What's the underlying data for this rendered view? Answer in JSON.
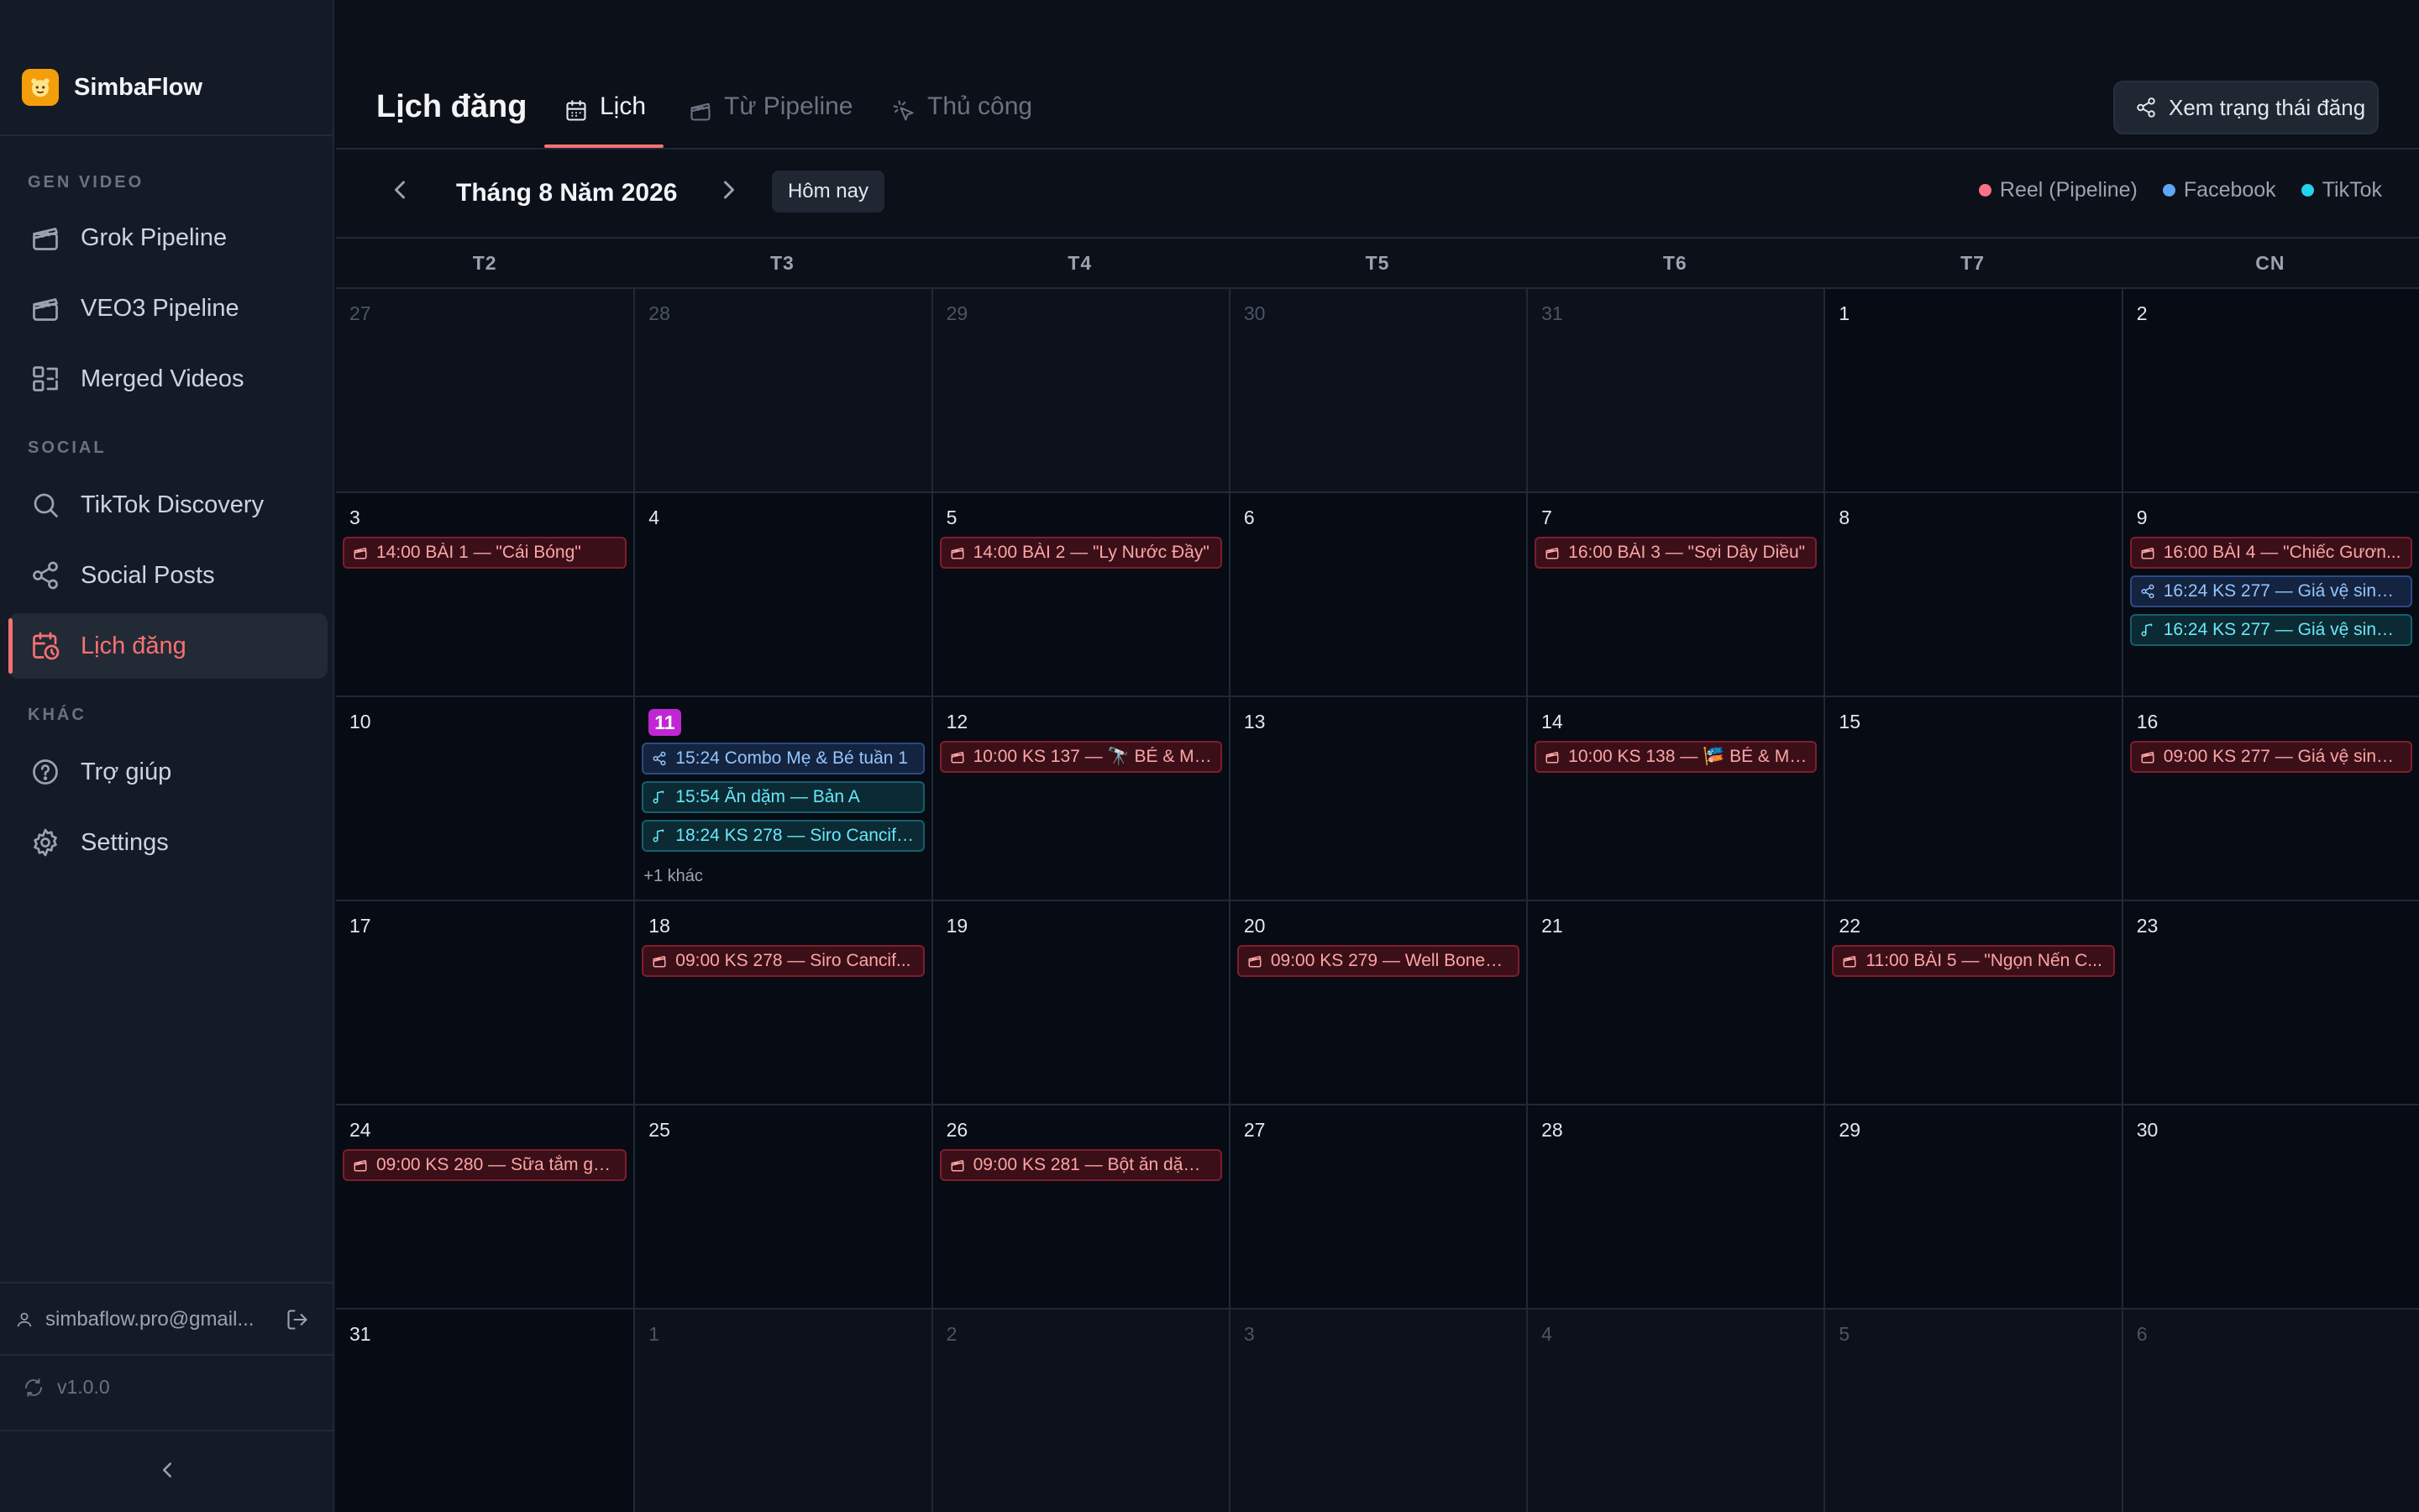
{
  "app": {
    "name": "SimbaFlow"
  },
  "sidebar": {
    "sections": [
      {
        "title": "GEN VIDEO",
        "items": [
          {
            "label": "Grok Pipeline",
            "icon": "clapperboard-icon"
          },
          {
            "label": "VEO3 Pipeline",
            "icon": "clapperboard-icon"
          },
          {
            "label": "Merged Videos",
            "icon": "merge-icon"
          }
        ]
      },
      {
        "title": "SOCIAL",
        "items": [
          {
            "label": "TikTok Discovery",
            "icon": "search-icon"
          },
          {
            "label": "Social Posts",
            "icon": "share-icon"
          },
          {
            "label": "Lịch đăng",
            "icon": "calendar-clock-icon",
            "active": true
          }
        ]
      },
      {
        "title": "KHÁC",
        "items": [
          {
            "label": "Trợ giúp",
            "icon": "help-circle-icon"
          },
          {
            "label": "Settings",
            "icon": "gear-icon"
          }
        ]
      }
    ],
    "user_email": "simbaflow.pro@gmail...",
    "version": "v1.0.0"
  },
  "header": {
    "title": "Lịch đăng",
    "tabs": [
      {
        "label": "Lịch",
        "icon": "calendar-icon",
        "active": true
      },
      {
        "label": "Từ Pipeline",
        "icon": "clapperboard-icon"
      },
      {
        "label": "Thủ công",
        "icon": "pointer-click-icon"
      }
    ],
    "status_button": "Xem trạng thái đăng"
  },
  "toolbar": {
    "month_label": "Tháng 8 Năm 2026",
    "today_label": "Hôm nay"
  },
  "legend": [
    {
      "label": "Reel (Pipeline)",
      "color": "#fb7185"
    },
    {
      "label": "Facebook",
      "color": "#60a5fa"
    },
    {
      "label": "TikTok",
      "color": "#22d3ee"
    }
  ],
  "colors": {
    "accent": "#f87171",
    "today": "#c026d3",
    "reel": "#fb7185",
    "facebook": "#60a5fa",
    "tiktok": "#22d3ee"
  },
  "weekdays": [
    "T2",
    "T3",
    "T4",
    "T5",
    "T6",
    "T7",
    "CN"
  ],
  "days": [
    {
      "d": "27",
      "out": true
    },
    {
      "d": "28",
      "out": true
    },
    {
      "d": "29",
      "out": true
    },
    {
      "d": "30",
      "out": true
    },
    {
      "d": "31",
      "out": true
    },
    {
      "d": "1"
    },
    {
      "d": "2"
    },
    {
      "d": "3",
      "events": [
        {
          "type": "reel",
          "text": "14:00 BÀI 1 — \"Cái Bóng\""
        }
      ]
    },
    {
      "d": "4"
    },
    {
      "d": "5",
      "events": [
        {
          "type": "reel",
          "text": "14:00 BÀI 2 — \"Ly Nước Đầy\""
        }
      ]
    },
    {
      "d": "6"
    },
    {
      "d": "7",
      "events": [
        {
          "type": "reel",
          "text": "16:00 BÀI 3 — \"Sợi Dây Diều\""
        }
      ]
    },
    {
      "d": "8"
    },
    {
      "d": "9",
      "events": [
        {
          "type": "reel",
          "text": "16:00 BÀI 4 — \"Chiếc Gươn..."
        },
        {
          "type": "facebook",
          "text": "16:24 KS 277 — Giá vệ sinh ..."
        },
        {
          "type": "tiktok",
          "text": "16:24 KS 277 — Giá vệ sinh ..."
        }
      ]
    },
    {
      "d": "10"
    },
    {
      "d": "11",
      "today": true,
      "events": [
        {
          "type": "facebook",
          "text": "15:24 Combo Mẹ & Bé tuần 1"
        },
        {
          "type": "tiktok",
          "text": "15:54 Ăn dặm — Bản A"
        },
        {
          "type": "tiktok",
          "text": "18:24 KS 278 — Siro Cancifo..."
        }
      ],
      "more": "+1 khác"
    },
    {
      "d": "12",
      "events": [
        {
          "type": "reel",
          "text": "10:00 KS 137 — 🔭 BÉ & MÍT ..."
        }
      ]
    },
    {
      "d": "13"
    },
    {
      "d": "14",
      "events": [
        {
          "type": "reel",
          "text": "10:00 KS 138 — 🎏 BÉ & MÍT ..."
        }
      ]
    },
    {
      "d": "15"
    },
    {
      "d": "16",
      "events": [
        {
          "type": "reel",
          "text": "09:00 KS 277 — Giá vệ sinh ..."
        }
      ]
    },
    {
      "d": "17"
    },
    {
      "d": "18",
      "events": [
        {
          "type": "reel",
          "text": "09:00 KS 278 — Siro Cancif..."
        }
      ]
    },
    {
      "d": "19"
    },
    {
      "d": "20",
      "events": [
        {
          "type": "reel",
          "text": "09:00 KS 279 — Well Bone+..."
        }
      ]
    },
    {
      "d": "21"
    },
    {
      "d": "22",
      "events": [
        {
          "type": "reel",
          "text": "11:00 BÀI 5 — \"Ngọn Nến C..."
        }
      ]
    },
    {
      "d": "23"
    },
    {
      "d": "24",
      "events": [
        {
          "type": "reel",
          "text": "09:00 KS 280 — Sữa tắm gộ..."
        }
      ]
    },
    {
      "d": "25"
    },
    {
      "d": "26",
      "events": [
        {
          "type": "reel",
          "text": "09:00 KS 281 — Bột ăn dặm ..."
        }
      ]
    },
    {
      "d": "27"
    },
    {
      "d": "28"
    },
    {
      "d": "29"
    },
    {
      "d": "30"
    },
    {
      "d": "31"
    },
    {
      "d": "1",
      "out": true
    },
    {
      "d": "2",
      "out": true
    },
    {
      "d": "3",
      "out": true
    },
    {
      "d": "4",
      "out": true
    },
    {
      "d": "5",
      "out": true
    },
    {
      "d": "6",
      "out": true
    }
  ]
}
